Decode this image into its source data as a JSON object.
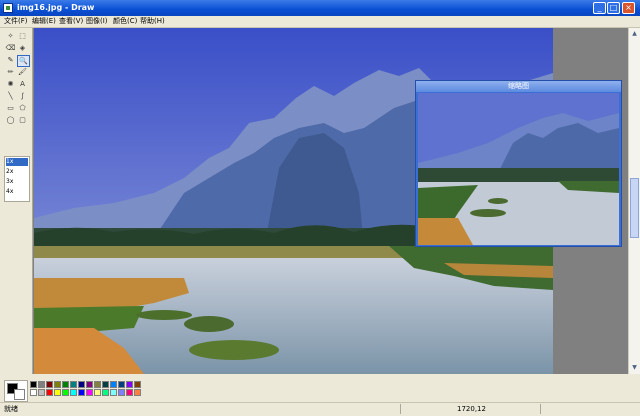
{
  "window": {
    "title": "img16.jpg - Draw",
    "app_icon": "paint-icon"
  },
  "window_controls": {
    "minimize": "_",
    "maximize": "□",
    "close": "×"
  },
  "menu": [
    {
      "label": "文件(F)"
    },
    {
      "label": "编辑(E)"
    },
    {
      "label": "查看(V)"
    },
    {
      "label": "图像(I)"
    },
    {
      "label": "颜色(C)"
    },
    {
      "label": "帮助(H)"
    }
  ],
  "tools": [
    {
      "name": "free-select-icon",
      "glyph": "✧"
    },
    {
      "name": "rect-select-icon",
      "glyph": "⬚"
    },
    {
      "name": "eraser-icon",
      "glyph": "⌫"
    },
    {
      "name": "fill-icon",
      "glyph": "◈"
    },
    {
      "name": "eyedropper-icon",
      "glyph": "✎"
    },
    {
      "name": "magnifier-icon",
      "glyph": "🔍"
    },
    {
      "name": "pencil-icon",
      "glyph": "✏"
    },
    {
      "name": "brush-icon",
      "glyph": "🖌"
    },
    {
      "name": "airbrush-icon",
      "glyph": "✺"
    },
    {
      "name": "text-icon",
      "glyph": "A"
    },
    {
      "name": "line-icon",
      "glyph": "╲"
    },
    {
      "name": "curve-icon",
      "glyph": "∫"
    },
    {
      "name": "rectangle-icon",
      "glyph": "▭"
    },
    {
      "name": "polygon-icon",
      "glyph": "⬠"
    },
    {
      "name": "ellipse-icon",
      "glyph": "◯"
    },
    {
      "name": "rounded-rect-icon",
      "glyph": "▢"
    }
  ],
  "tool_options": [
    "1x",
    "2x",
    "3x",
    "4x"
  ],
  "thumbnail": {
    "title": "缩略图"
  },
  "palette": {
    "foreground": "#000000",
    "background": "#ffffff",
    "colors": [
      "#000000",
      "#808080",
      "#800000",
      "#808000",
      "#008000",
      "#008080",
      "#000080",
      "#800080",
      "#808040",
      "#004040",
      "#0080ff",
      "#004080",
      "#8000ff",
      "#804000",
      "#ffffff",
      "#c0c0c0",
      "#ff0000",
      "#ffff00",
      "#00ff00",
      "#00ffff",
      "#0000ff",
      "#ff00ff",
      "#ffff80",
      "#00ff80",
      "#80ffff",
      "#8080ff",
      "#ff0080",
      "#ff8040"
    ]
  },
  "status": {
    "text": "就绪",
    "coords": "1720,12"
  },
  "scrollbar": {
    "up": "▲",
    "down": "▼"
  }
}
